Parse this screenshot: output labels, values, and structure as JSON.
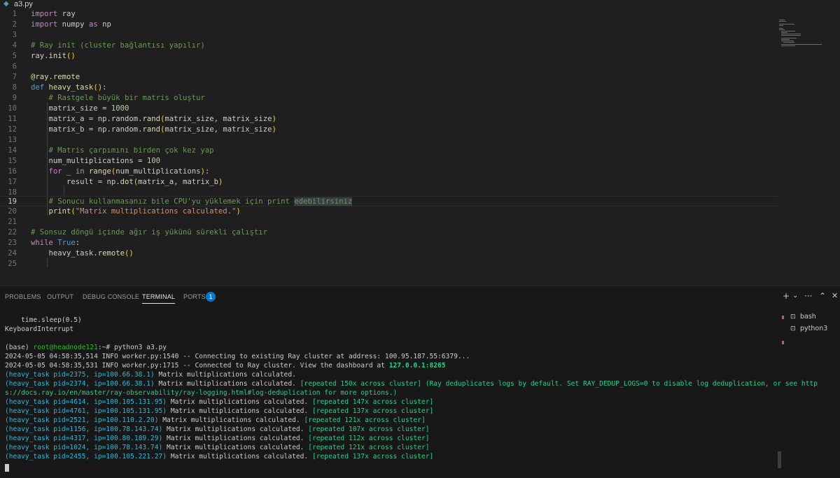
{
  "editor": {
    "tab_icon": "python-file-icon",
    "filename": "a3.py",
    "line_numbers": [
      "1",
      "2",
      "3",
      "4",
      "5",
      "6",
      "7",
      "8",
      "9",
      "10",
      "11",
      "12",
      "13",
      "14",
      "15",
      "16",
      "17",
      "18",
      "19",
      "20",
      "21",
      "22",
      "23",
      "24",
      "25"
    ],
    "active_line": "19"
  },
  "panel": {
    "tabs": [
      "PROBLEMS",
      "OUTPUT",
      "DEBUG CONSOLE",
      "TERMINAL",
      "PORTS"
    ],
    "active_tab": "TERMINAL",
    "ports_badge": "1",
    "actions": {
      "new_terminal": "+",
      "dropdown": "⌄",
      "more": "···",
      "maximize": "⌃",
      "close": "✕"
    },
    "terminals": [
      {
        "label": "bash",
        "icon": "terminal-icon"
      },
      {
        "label": "python3",
        "icon": "terminal-icon"
      }
    ]
  },
  "terminal": {
    "lines": [
      "    time.sleep(0.5)",
      "KeyboardInterrupt",
      "",
      "(base) root@headnode121:~# python3 a3.py",
      "2024-05-05 04:58:35,514 INFO worker.py:1540 -- Connecting to existing Ray cluster at address: 100.95.187.55:6379...",
      "2024-05-05 04:58:35,531 INFO worker.py:1715 -- Connected to Ray cluster. View the dashboard at 127.0.0.1:8265",
      "(heavy_task pid=2375, ip=100.66.38.1) Matrix multiplications calculated.",
      "(heavy_task pid=2374, ip=100.66.38.1) Matrix multiplications calculated. [repeated 150x across cluster] (Ray deduplicates logs by default. Set RAY_DEDUP_LOGS=0 to disable log deduplication, or see http",
      "s://docs.ray.io/en/master/ray-observability/ray-logging.html#log-deduplication for more options.)",
      "(heavy_task pid=4614, ip=100.105.131.95) Matrix multiplications calculated. [repeated 147x across cluster]",
      "(heavy_task pid=4761, ip=100.105.131.95) Matrix multiplications calculated. [repeated 137x across cluster]",
      "(heavy_task pid=2521, ip=100.110.2.20) Matrix multiplications calculated. [repeated 121x across cluster]",
      "(heavy_task pid=1156, ip=100.78.143.74) Matrix multiplications calculated. [repeated 107x across cluster]",
      "(heavy_task pid=4317, ip=100.80.189.29) Matrix multiplications calculated. [repeated 112x across cluster]",
      "(heavy_task pid=1024, ip=100.78.143.74) Matrix multiplications calculated. [repeated 121x across cluster]",
      "(heavy_task pid=2455, ip=100.105.221.27) Matrix multiplications calculated. [repeated 137x across cluster]"
    ]
  }
}
